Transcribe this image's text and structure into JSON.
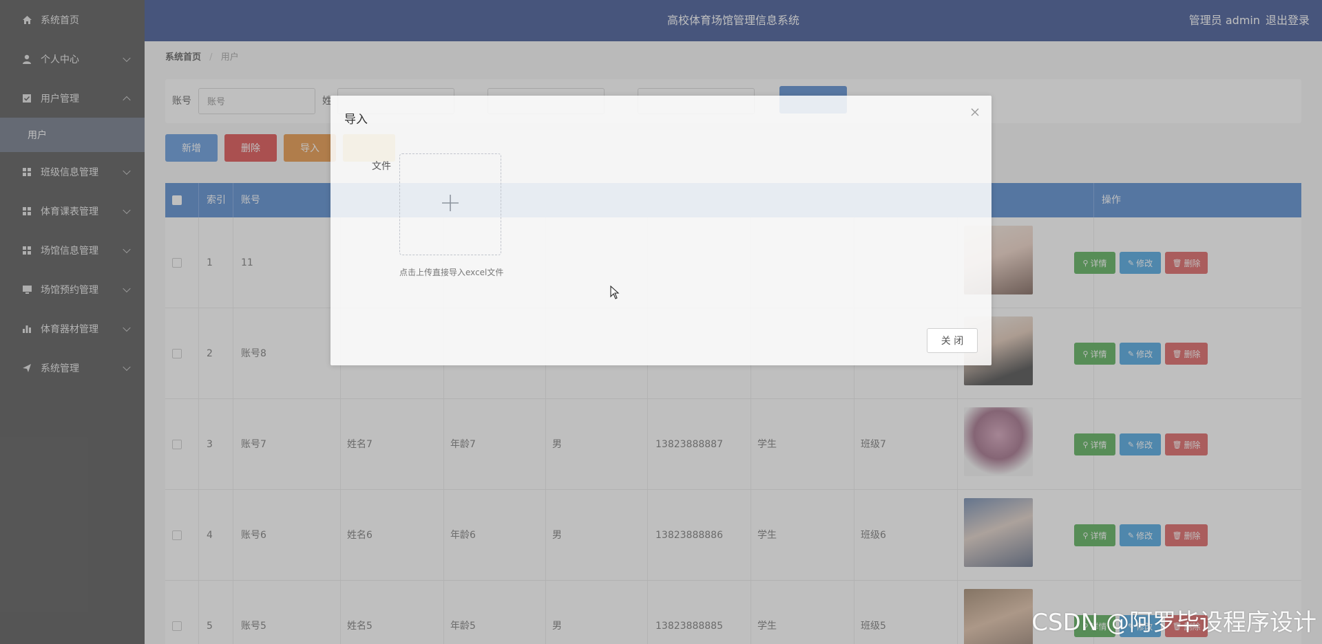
{
  "header": {
    "title": "高校体育场馆管理信息系统",
    "user": "管理员 admin",
    "logout": "退出登录"
  },
  "sidebar": {
    "items": [
      {
        "label": "系统首页",
        "icon": "home-icon"
      },
      {
        "label": "个人中心",
        "icon": "user-icon"
      },
      {
        "label": "用户管理",
        "icon": "checkbox-icon",
        "expanded": true
      },
      {
        "label": "班级信息管理",
        "icon": "grid-icon"
      },
      {
        "label": "体育课表管理",
        "icon": "grid-icon"
      },
      {
        "label": "场馆信息管理",
        "icon": "grid-icon"
      },
      {
        "label": "场馆预约管理",
        "icon": "monitor-icon"
      },
      {
        "label": "体育器材管理",
        "icon": "bar-chart-icon"
      },
      {
        "label": "系统管理",
        "icon": "send-icon"
      }
    ],
    "sub_item": "用户"
  },
  "breadcrumb": {
    "home": "系统首页",
    "current": "用户"
  },
  "search": {
    "account_label": "账号",
    "account_placeholder": "账号",
    "name_label": "姓"
  },
  "toolbar": {
    "add": "新增",
    "delete": "删除",
    "import": "导入"
  },
  "table": {
    "headers": [
      "索引",
      "账号",
      "操作"
    ],
    "rows": [
      {
        "index": "1",
        "account": "11",
        "name": "",
        "age": "",
        "gender": "",
        "phone": "",
        "role": "",
        "class": ""
      },
      {
        "index": "2",
        "account": "账号8",
        "name": "",
        "age": "",
        "gender": "",
        "phone": "",
        "role": "",
        "class": ""
      },
      {
        "index": "3",
        "account": "账号7",
        "name": "姓名7",
        "age": "年龄7",
        "gender": "男",
        "phone": "13823888887",
        "role": "学生",
        "class": "班级7"
      },
      {
        "index": "4",
        "account": "账号6",
        "name": "姓名6",
        "age": "年龄6",
        "gender": "男",
        "phone": "13823888886",
        "role": "学生",
        "class": "班级6"
      },
      {
        "index": "5",
        "account": "账号5",
        "name": "姓名5",
        "age": "年龄5",
        "gender": "男",
        "phone": "13823888885",
        "role": "学生",
        "class": "班级5"
      }
    ],
    "ops": {
      "detail": "详情",
      "edit": "修改",
      "delete": "删除"
    }
  },
  "dialog": {
    "title": "导入",
    "file_label": "文件",
    "upload_tip": "点击上传直接导入excel文件",
    "close_button": "关 闭"
  },
  "watermark": "CSDN @阿罗毕设程序设计",
  "colors": {
    "header": "#0e2a78",
    "sidebar": "#2b2b2b",
    "primary": "#2b6cc2",
    "danger": "#d42121",
    "warning": "#e07b16",
    "success": "#2f9a2f"
  }
}
